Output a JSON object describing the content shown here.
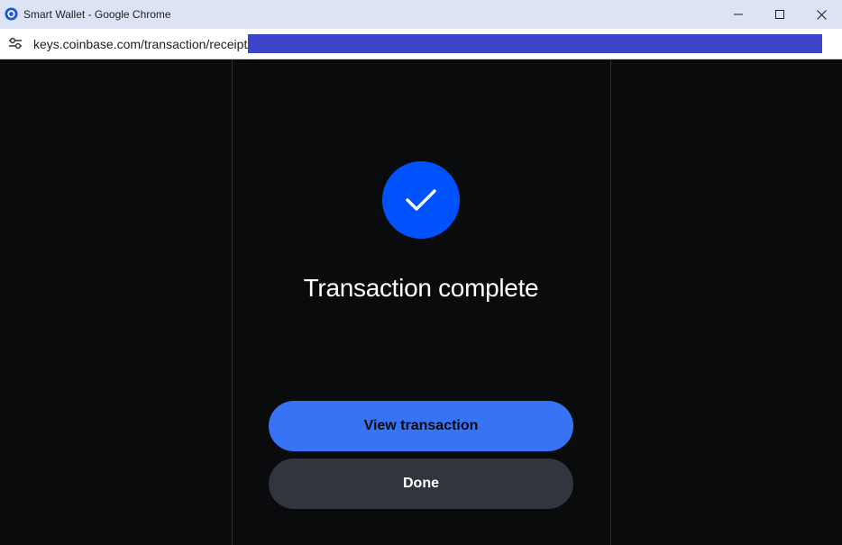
{
  "window": {
    "title": "Smart Wallet - Google Chrome",
    "icons": {
      "app": "coinbase-circle-icon",
      "minimize": "minimize-icon",
      "maximize": "maximize-icon",
      "close": "close-icon"
    }
  },
  "addressbar": {
    "url": "keys.coinbase.com/transaction/receipt/",
    "site_info_icon": "site-settings-icon"
  },
  "receipt": {
    "status_icon": "checkmark-icon",
    "heading": "Transaction complete",
    "view_button_label": "View transaction",
    "done_button_label": "Done"
  },
  "colors": {
    "background": "#0a0b0d",
    "accent_blue": "#0052ff",
    "primary_button": "#3773f5",
    "secondary_button": "#32353d",
    "titlebar": "#dce3f3",
    "url_selection": "#3d44c8"
  }
}
